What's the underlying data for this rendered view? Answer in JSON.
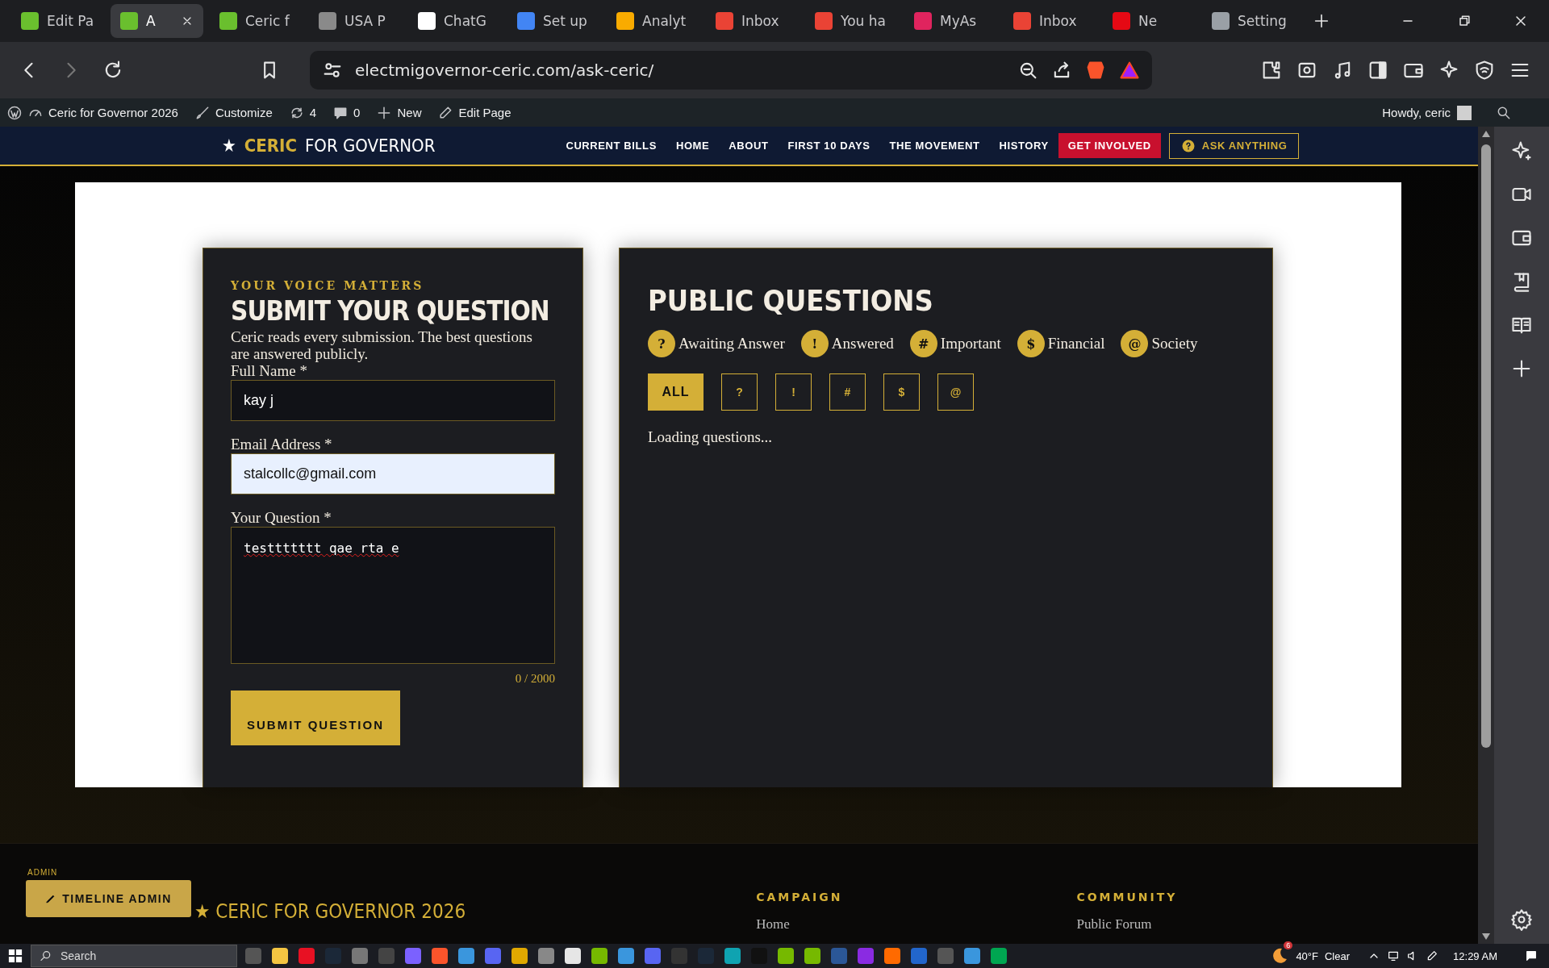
{
  "browser": {
    "tabs": [
      {
        "label": "Edit Pa",
        "selected": false
      },
      {
        "label": "A",
        "selected": true
      },
      {
        "label": "Ceric f",
        "selected": false
      },
      {
        "label": "USA P",
        "selected": false
      },
      {
        "label": "ChatG",
        "selected": false
      },
      {
        "label": "Set up",
        "selected": false
      },
      {
        "label": "Analyt",
        "selected": false
      },
      {
        "label": "Inbox",
        "selected": false
      },
      {
        "label": "You ha",
        "selected": false
      },
      {
        "label": "MyAs",
        "selected": false
      },
      {
        "label": "Inbox",
        "selected": false
      },
      {
        "label": "Ne",
        "selected": false
      },
      {
        "label": "Setting",
        "selected": false
      }
    ],
    "url": "electmigovernor-ceric.com/ask-ceric/"
  },
  "admin_bar": {
    "site_name": "Ceric for Governor 2026",
    "customize": "Customize",
    "updates": "4",
    "comments": "0",
    "new": "New",
    "edit_page": "Edit Page",
    "greeting": "Howdy, ceric"
  },
  "site_header": {
    "logo_star": "★",
    "logo_first": "CERIC",
    "logo_rest": "FOR GOVERNOR",
    "nav": [
      {
        "label": "CURRENT BILLS",
        "kind": "link"
      },
      {
        "label": "HOME",
        "kind": "link"
      },
      {
        "label": "ABOUT",
        "kind": "link"
      },
      {
        "label": "FIRST 10 DAYS",
        "kind": "link"
      },
      {
        "label": "THE MOVEMENT",
        "kind": "link"
      },
      {
        "label": "HISTORY",
        "kind": "link"
      },
      {
        "label": "GET INVOLVED",
        "kind": "cta"
      },
      {
        "label": "ASK ANYTHING",
        "kind": "ask"
      }
    ]
  },
  "question_form": {
    "kicker": "YOUR VOICE MATTERS",
    "title": "SUBMIT YOUR QUESTION",
    "description": "Ceric reads every submission. The best questions are answered publicly.",
    "fields": [
      {
        "label": "Full Name *",
        "value": "kay j",
        "kind": "input",
        "autofilled": false
      },
      {
        "label": "Email Address *",
        "value": "stalcollc@gmail.com",
        "kind": "input",
        "autofilled": true
      },
      {
        "label": "Your Question *",
        "value": "testtttttt qae rta e",
        "kind": "textarea",
        "autofilled": false
      }
    ],
    "counter": "0 / 2000",
    "submit": "SUBMIT QUESTION"
  },
  "public_questions": {
    "title": "PUBLIC QUESTIONS",
    "legend": [
      {
        "symbol": "?",
        "label": "Awaiting Answer"
      },
      {
        "symbol": "!",
        "label": "Answered"
      },
      {
        "symbol": "#",
        "label": "Important"
      },
      {
        "symbol": "$",
        "label": "Financial"
      },
      {
        "symbol": "@",
        "label": "Society"
      }
    ],
    "filters": [
      {
        "label": "ALL",
        "selected": true
      },
      {
        "label": "?",
        "selected": false
      },
      {
        "label": "!",
        "selected": false
      },
      {
        "label": "#",
        "selected": false
      },
      {
        "label": "$",
        "selected": false
      },
      {
        "label": "@",
        "selected": false
      }
    ],
    "status": "Loading questions..."
  },
  "footer": {
    "admin_label": "ADMIN",
    "admin_button": "TIMELINE ADMIN",
    "brand": "★ CERIC FOR GOVERNOR 2026",
    "columns": [
      {
        "heading": "CAMPAIGN",
        "links": [
          "Home"
        ]
      },
      {
        "heading": "COMMUNITY",
        "links": [
          "Public Forum"
        ]
      }
    ]
  },
  "taskbar": {
    "search_placeholder": "Search",
    "weather_badge": "6",
    "temperature": "40°F",
    "condition": "Clear",
    "time": "12:29 AM"
  }
}
